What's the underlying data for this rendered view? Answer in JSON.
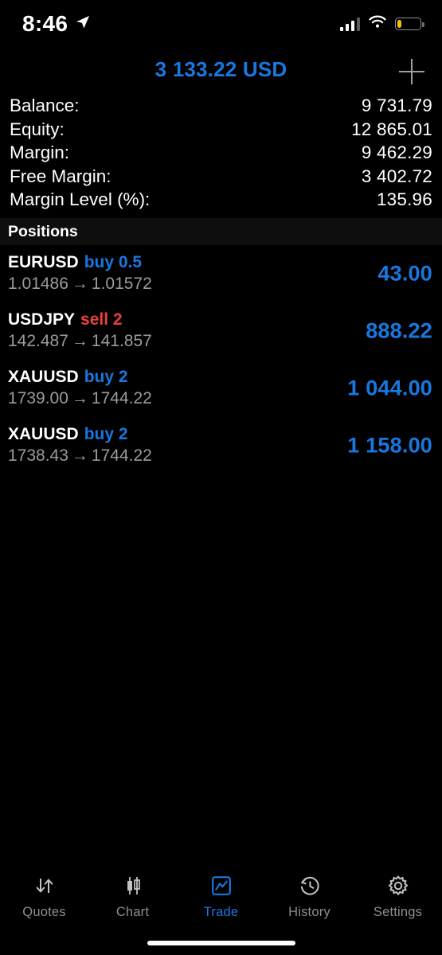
{
  "status_bar": {
    "time": "8:46",
    "location_icon": "location-arrow-icon",
    "cellular_icon": "cellular-signal-icon",
    "wifi_icon": "wifi-icon",
    "battery_icon": "battery-low-icon"
  },
  "header": {
    "title": "3 133.22 USD",
    "title_color": "#1878e0",
    "add_button_label": "+"
  },
  "summary": {
    "rows": [
      {
        "label": "Balance:",
        "value": "9 731.79"
      },
      {
        "label": "Equity:",
        "value": "12 865.01"
      },
      {
        "label": "Margin:",
        "value": "9 462.29"
      },
      {
        "label": "Free Margin:",
        "value": "3 402.72"
      },
      {
        "label": "Margin Level (%):",
        "value": "135.96"
      }
    ]
  },
  "positions_section": {
    "header": "Positions",
    "arrow_glyph": "→",
    "buy_color": "#1878e0",
    "sell_color": "#e8413c",
    "profit_color": "#1878e0",
    "rows": [
      {
        "symbol": "EURUSD",
        "side": "buy",
        "volume": "0.5",
        "side_volume": "buy 0.5",
        "open_price": "1.01486",
        "current_price": "1.01572",
        "profit": "43.00"
      },
      {
        "symbol": "USDJPY",
        "side": "sell",
        "volume": "2",
        "side_volume": "sell 2",
        "open_price": "142.487",
        "current_price": "141.857",
        "profit": "888.22"
      },
      {
        "symbol": "XAUUSD",
        "side": "buy",
        "volume": "2",
        "side_volume": "buy 2",
        "open_price": "1739.00",
        "current_price": "1744.22",
        "profit": "1 044.00"
      },
      {
        "symbol": "XAUUSD",
        "side": "buy",
        "volume": "2",
        "side_volume": "buy 2",
        "open_price": "1738.43",
        "current_price": "1744.22",
        "profit": "1 158.00"
      }
    ]
  },
  "tab_bar": {
    "active": "Trade",
    "active_color": "#1878e0",
    "inactive_color": "#8e8e8e",
    "tabs": [
      {
        "label": "Quotes",
        "icon": "updown-arrows-icon"
      },
      {
        "label": "Chart",
        "icon": "candlestick-icon"
      },
      {
        "label": "Trade",
        "icon": "trade-linechart-icon"
      },
      {
        "label": "History",
        "icon": "clock-history-icon"
      },
      {
        "label": "Settings",
        "icon": "gear-icon"
      }
    ]
  }
}
